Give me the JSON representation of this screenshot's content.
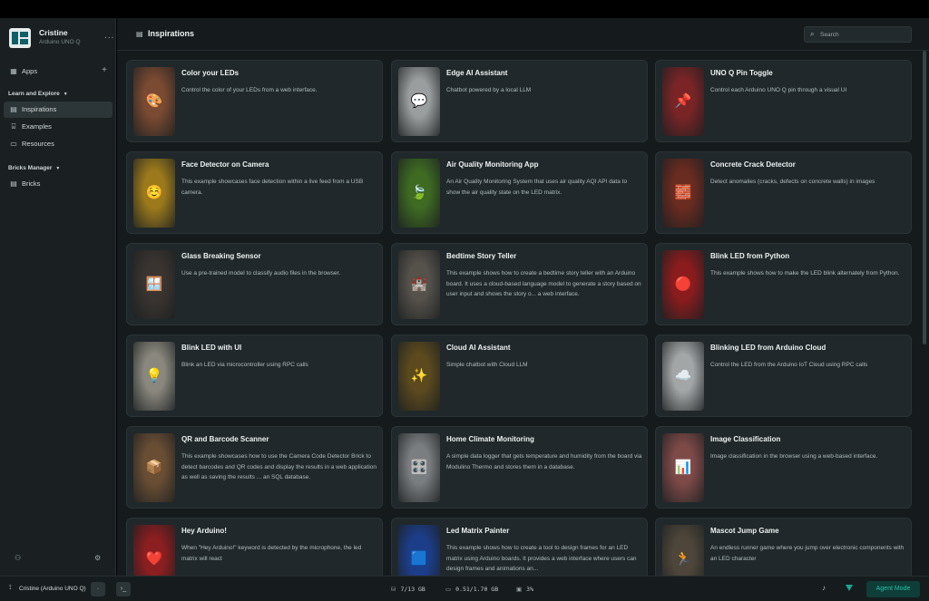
{
  "device": {
    "name": "Cristine",
    "model": "Arduino UNO Q",
    "more_glyph": "..."
  },
  "sidebar": {
    "apps_label": "Apps",
    "add_glyph": "+",
    "learn_section": "Learn and Explore",
    "learn_items": [
      {
        "label": "Inspirations",
        "icon": "lightbulb-icon",
        "glyph": "▤"
      },
      {
        "label": "Examples",
        "icon": "code-icon",
        "glyph": "⌸"
      },
      {
        "label": "Resources",
        "icon": "book-icon",
        "glyph": "▭"
      }
    ],
    "bricks_section": "Bricks Manager",
    "bricks_items": [
      {
        "label": "Bricks",
        "icon": "bricks-icon",
        "glyph": "▤"
      }
    ]
  },
  "header": {
    "title": "Inspirations",
    "search_placeholder": "Search"
  },
  "cards": [
    {
      "title": "Color your LEDs",
      "desc": "Control the color of your LEDs from a web interface.",
      "emoji": "🎨",
      "color": "#7a4a32"
    },
    {
      "title": "Edge AI Assistant",
      "desc": "Chatbot powered by a local LLM",
      "emoji": "💬",
      "color": "#9a9e9f"
    },
    {
      "title": "UNO Q Pin Toggle",
      "desc": "Control each Arduino UNO Q pin through a visual UI",
      "emoji": "📌",
      "color": "#7a2426"
    },
    {
      "title": "Face Detector on Camera",
      "desc": "This example showcases face detection within a live feed from a USB camera.",
      "emoji": "☺️",
      "color": "#9c7a1c"
    },
    {
      "title": "Air Quality Monitoring App",
      "desc": "An Air Quality Monitoring System that uses air quality AQI API data to show the air quality state on the LED matrix.",
      "emoji": "🍃",
      "color": "#3e6a22"
    },
    {
      "title": "Concrete Crack Detector",
      "desc": "Detect anomalies (cracks, defects on concrete walls) in images",
      "emoji": "🧱",
      "color": "#6a2b20"
    },
    {
      "title": "Glass Breaking Sensor",
      "desc": "Use a pre-trained model to classify audio files in the browser.",
      "emoji": "🪟",
      "color": "#3a3430"
    },
    {
      "title": "Bedtime Story Teller",
      "desc": "This example shows how to create a bedtime story teller with an Arduino board. It uses a cloud-based language model to generate a story based on user input and shows the story o... a web interface.",
      "emoji": "🏰",
      "color": "#55514b"
    },
    {
      "title": "Blink LED from Python",
      "desc": "This example shows how to make the LED blink alternately from Python.",
      "emoji": "🔴",
      "color": "#8a1c1e"
    },
    {
      "title": "Blink LED with UI",
      "desc": "Blink an LED via microcontroller using RPC calls",
      "emoji": "💡",
      "color": "#8a887e"
    },
    {
      "title": "Cloud AI Assistant",
      "desc": "Simple chatbot with Cloud LLM",
      "emoji": "✨",
      "color": "#5c4a1e"
    },
    {
      "title": "Blinking LED from Arduino Cloud",
      "desc": "Control the LED from the Arduino IoT Cloud using RPC calls",
      "emoji": "☁️",
      "color": "#a2a6a7"
    },
    {
      "title": "QR and Barcode Scanner",
      "desc": "This example showcases how to use the Camera Code Detector Brick to detect barcodes and QR codes and display the results in a web application as well as saving the results ... an SQL database.",
      "emoji": "📦",
      "color": "#6a4e34"
    },
    {
      "title": "Home Climate Monitoring",
      "desc": "A simple data logger that gets temperature and humidity from the board via Modulino Thermo and stores them in a database.",
      "emoji": "🎛️",
      "color": "#7a7e80"
    },
    {
      "title": "Image Classification",
      "desc": "Image classification in the browser using a web-based interface.",
      "emoji": "📊",
      "color": "#7e4a48"
    },
    {
      "title": "Hey Arduino!",
      "desc": "When \"Hey Arduino!\" keyword is detected by the microphone, the led matrix will react",
      "emoji": "❤️",
      "color": "#8a1e20"
    },
    {
      "title": "Led Matrix Painter",
      "desc": "This example shows how to create a tool to design frames for an LED matrix using Arduino boards. It provides a web interface where users can design frames and animations an...",
      "emoji": "🟦",
      "color": "#1c3e8a"
    },
    {
      "title": "Mascot Jump Game",
      "desc": "An endless runner game where you jump over electronic components with an LED character",
      "emoji": "🏃",
      "color": "#4e463a"
    }
  ],
  "statusbar": {
    "board_label": "Cristine (Arduino UNO Q)",
    "storage": "7/13 GB",
    "memory": "0.51/1.70 GB",
    "cpu": "3%",
    "agent_button": "Agent Mode"
  }
}
